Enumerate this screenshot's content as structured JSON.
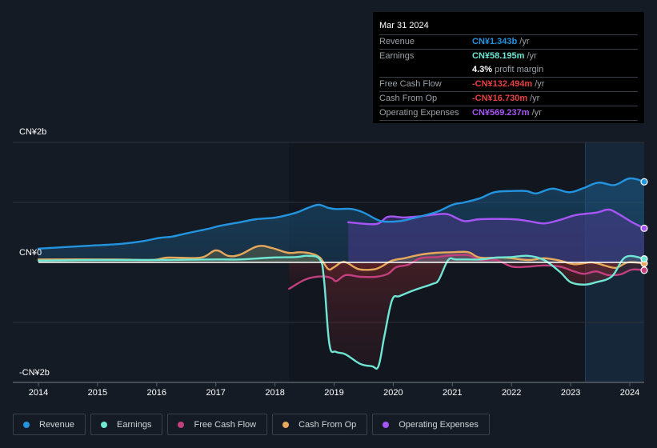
{
  "tooltip": {
    "date": "Mar 31 2024",
    "rows": [
      {
        "label": "Revenue",
        "value": "CN¥1.343b",
        "unit": "/yr",
        "color": "#2394df"
      },
      {
        "label": "Earnings",
        "value": "CN¥58.195m",
        "unit": "/yr",
        "color": "#6ee7d4"
      },
      {
        "label": "",
        "value": "4.3%",
        "unit": "profit margin",
        "color": "#ffffff"
      },
      {
        "label": "Free Cash Flow",
        "value": "-CN¥132.494m",
        "unit": "/yr",
        "color": "#e64141"
      },
      {
        "label": "Cash From Op",
        "value": "-CN¥16.730m",
        "unit": "/yr",
        "color": "#e64141"
      },
      {
        "label": "Operating Expenses",
        "value": "CN¥569.237m",
        "unit": "/yr",
        "color": "#a855f7"
      }
    ]
  },
  "legend": [
    {
      "label": "Revenue",
      "color": "#2394df"
    },
    {
      "label": "Earnings",
      "color": "#6ee7d4"
    },
    {
      "label": "Free Cash Flow",
      "color": "#c2407f"
    },
    {
      "label": "Cash From Op",
      "color": "#e8a85c"
    },
    {
      "label": "Operating Expenses",
      "color": "#a855f7"
    }
  ],
  "chart_data": {
    "type": "area",
    "title": "",
    "xlabel": "",
    "ylabel": "",
    "unit": "CN¥ billions",
    "ylim": [
      -2,
      2
    ],
    "xlim": [
      2013.6,
      2024.25
    ],
    "y_tick_labels": [
      {
        "value": 2,
        "label": "CN¥2b"
      },
      {
        "value": 0,
        "label": "CN¥0"
      },
      {
        "value": -2,
        "label": "-CN¥2b"
      }
    ],
    "gridlines_at": [
      2,
      1,
      0,
      -1
    ],
    "x_ticks": [
      "2014",
      "2015",
      "2016",
      "2017",
      "2018",
      "2019",
      "2020",
      "2021",
      "2022",
      "2023",
      "2024"
    ],
    "highlight_from": 2023.25,
    "legend_position": "bottom",
    "series": [
      {
        "name": "Revenue",
        "color": "#2394df",
        "x": [
          2014.0,
          2014.7,
          2015.4,
          2015.8,
          2016.05,
          2016.26,
          2016.53,
          2016.87,
          2017.07,
          2017.41,
          2017.68,
          2018.02,
          2018.36,
          2018.56,
          2018.74,
          2018.9,
          2019.03,
          2019.3,
          2019.5,
          2019.71,
          2019.85,
          2020.12,
          2020.39,
          2020.73,
          2021.0,
          2021.2,
          2021.47,
          2021.71,
          2022.01,
          2022.25,
          2022.42,
          2022.69,
          2022.98,
          2023.22,
          2023.47,
          2023.74,
          2024.0,
          2024.25
        ],
        "values": [
          0.23,
          0.27,
          0.31,
          0.36,
          0.41,
          0.43,
          0.49,
          0.56,
          0.61,
          0.67,
          0.72,
          0.75,
          0.83,
          0.91,
          0.96,
          0.91,
          0.89,
          0.89,
          0.83,
          0.72,
          0.68,
          0.69,
          0.75,
          0.84,
          0.96,
          1.0,
          1.07,
          1.17,
          1.19,
          1.19,
          1.15,
          1.23,
          1.17,
          1.24,
          1.33,
          1.29,
          1.4,
          1.343
        ]
      },
      {
        "name": "Earnings",
        "color": "#6ee7d4",
        "x": [
          2014.0,
          2015.0,
          2016.0,
          2017.0,
          2017.41,
          2017.95,
          2018.36,
          2018.56,
          2018.76,
          2018.83,
          2018.92,
          2019.03,
          2019.19,
          2019.44,
          2019.64,
          2019.75,
          2019.85,
          2019.98,
          2020.11,
          2020.39,
          2020.66,
          2020.77,
          2020.93,
          2021.07,
          2021.47,
          2021.74,
          2022.01,
          2022.28,
          2022.55,
          2022.82,
          2023.0,
          2023.23,
          2023.43,
          2023.7,
          2023.93,
          2024.25
        ],
        "values": [
          0.03,
          0.04,
          0.04,
          0.05,
          0.05,
          0.08,
          0.09,
          0.11,
          0.05,
          -0.29,
          -1.36,
          -1.49,
          -1.53,
          -1.69,
          -1.73,
          -1.73,
          -1.23,
          -0.63,
          -0.56,
          -0.45,
          -0.36,
          -0.29,
          0.04,
          0.05,
          0.05,
          0.08,
          0.09,
          0.11,
          0.04,
          -0.16,
          -0.33,
          -0.37,
          -0.33,
          -0.23,
          0.09,
          0.058
        ]
      },
      {
        "name": "Free Cash Flow",
        "color": "#c2407f",
        "x": [
          2018.24,
          2018.5,
          2018.7,
          2018.88,
          2018.97,
          2019.04,
          2019.2,
          2019.44,
          2019.71,
          2019.91,
          2020.05,
          2020.25,
          2020.46,
          2020.73,
          2021.0,
          2021.27,
          2021.47,
          2021.74,
          2022.01,
          2022.28,
          2022.55,
          2022.82,
          2023.06,
          2023.23,
          2023.43,
          2023.63,
          2023.84,
          2024.04,
          2024.25
        ],
        "values": [
          -0.44,
          -0.29,
          -0.24,
          -0.24,
          -0.27,
          -0.31,
          -0.21,
          -0.24,
          -0.24,
          -0.19,
          -0.08,
          -0.04,
          0.07,
          0.09,
          0.12,
          0.12,
          0.04,
          0.04,
          -0.07,
          -0.07,
          -0.05,
          -0.07,
          -0.15,
          -0.19,
          -0.15,
          -0.21,
          -0.2,
          -0.12,
          -0.132
        ]
      },
      {
        "name": "Cash From Op",
        "color": "#e8a85c",
        "x": [
          2014.0,
          2015.25,
          2015.92,
          2016.19,
          2016.74,
          2017.0,
          2017.21,
          2017.41,
          2017.71,
          2017.95,
          2018.22,
          2018.42,
          2018.6,
          2018.76,
          2018.9,
          2019.0,
          2019.17,
          2019.41,
          2019.64,
          2019.78,
          2019.98,
          2020.19,
          2020.46,
          2020.73,
          2021.0,
          2021.27,
          2021.47,
          2021.88,
          2022.28,
          2022.55,
          2022.82,
          2023.06,
          2023.36,
          2023.57,
          2023.77,
          2023.97,
          2024.25
        ],
        "values": [
          0.05,
          0.05,
          0.04,
          0.08,
          0.08,
          0.2,
          0.11,
          0.13,
          0.27,
          0.24,
          0.16,
          0.17,
          0.15,
          0.08,
          -0.11,
          -0.08,
          0.01,
          -0.11,
          -0.12,
          -0.08,
          0.03,
          0.07,
          0.13,
          0.16,
          0.17,
          0.17,
          0.08,
          0.08,
          0.04,
          0.07,
          0.03,
          -0.03,
          0.0,
          -0.05,
          -0.09,
          0.0,
          -0.017
        ]
      },
      {
        "name": "Operating Expenses",
        "color": "#a855f7",
        "x": [
          2019.24,
          2019.71,
          2019.91,
          2020.19,
          2020.46,
          2020.73,
          2020.93,
          2021.2,
          2021.47,
          2022.01,
          2022.28,
          2022.55,
          2022.82,
          2023.09,
          2023.43,
          2023.63,
          2023.77,
          2024.04,
          2024.25
        ],
        "values": [
          0.67,
          0.64,
          0.76,
          0.75,
          0.77,
          0.8,
          0.8,
          0.69,
          0.72,
          0.72,
          0.69,
          0.65,
          0.71,
          0.79,
          0.83,
          0.88,
          0.83,
          0.67,
          0.569
        ]
      }
    ]
  }
}
